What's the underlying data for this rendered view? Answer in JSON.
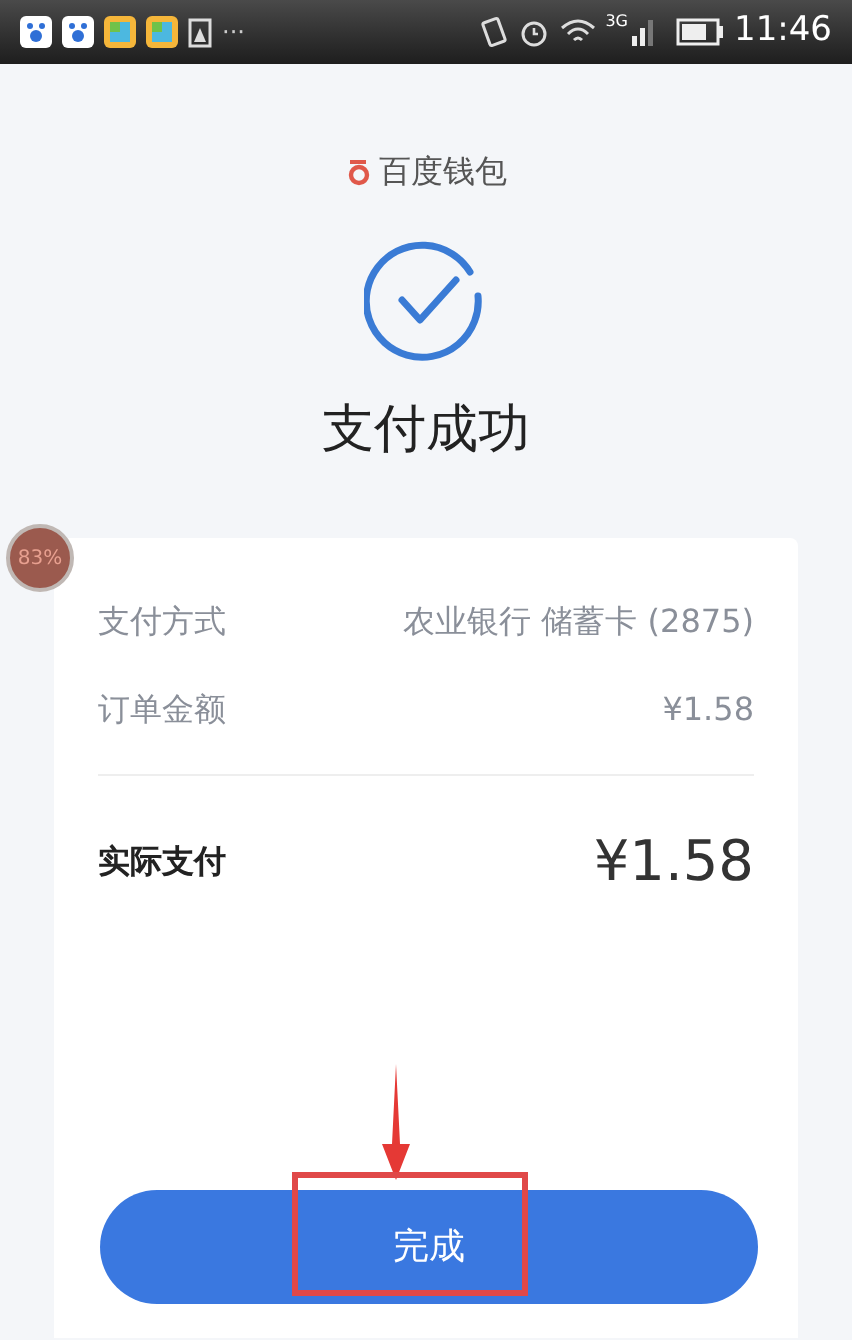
{
  "status_bar": {
    "more": "···",
    "network": "3G",
    "time": "11:46"
  },
  "brand": {
    "name": "百度钱包"
  },
  "title": "支付成功",
  "floating_badge": "83%",
  "details": [
    {
      "label": "支付方式",
      "value": "农业银行 储蓄卡 (2875)"
    },
    {
      "label": "订单金额",
      "value": "¥1.58"
    }
  ],
  "total": {
    "label": "实际支付",
    "value": "¥1.58"
  },
  "done_button": "完成"
}
